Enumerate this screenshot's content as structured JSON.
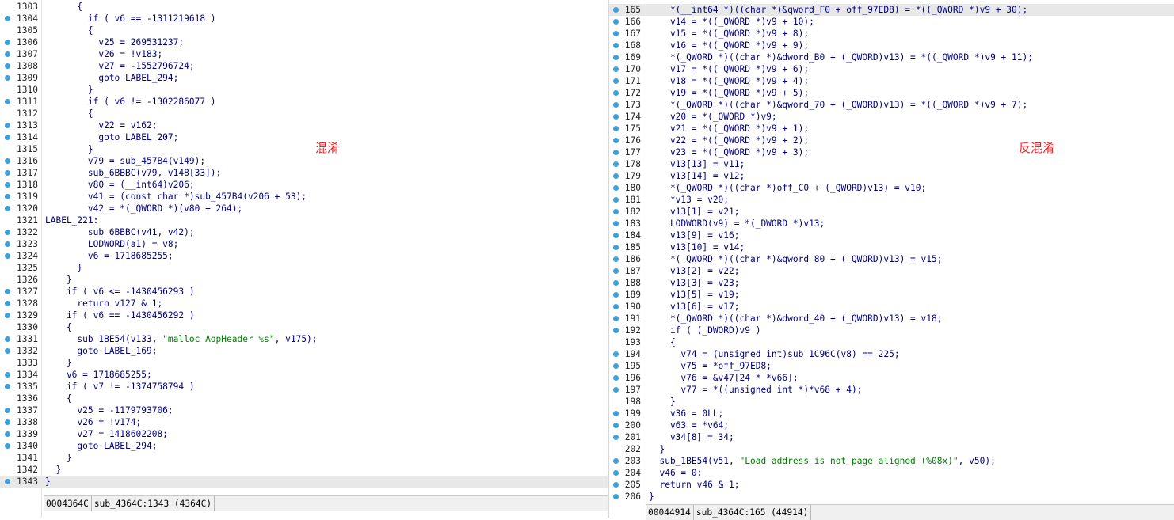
{
  "left_pane": {
    "lines": [
      {
        "num": "1303",
        "dot": false,
        "text": "      {"
      },
      {
        "num": "1304",
        "dot": true,
        "text": "        if ( v6 == -1311219618 )"
      },
      {
        "num": "1305",
        "dot": false,
        "text": "        {"
      },
      {
        "num": "1306",
        "dot": true,
        "text": "          v25 = 269531237;"
      },
      {
        "num": "1307",
        "dot": true,
        "text": "          v26 = !v183;"
      },
      {
        "num": "1308",
        "dot": true,
        "text": "          v27 = -1552796724;"
      },
      {
        "num": "1309",
        "dot": true,
        "text": "          goto LABEL_294;"
      },
      {
        "num": "1310",
        "dot": false,
        "text": "        }"
      },
      {
        "num": "1311",
        "dot": true,
        "text": "        if ( v6 != -1302286077 )"
      },
      {
        "num": "1312",
        "dot": false,
        "text": "        {"
      },
      {
        "num": "1313",
        "dot": true,
        "text": "          v22 = v162;"
      },
      {
        "num": "1314",
        "dot": true,
        "text": "          goto LABEL_207;"
      },
      {
        "num": "1315",
        "dot": false,
        "text": "        }"
      },
      {
        "num": "1316",
        "dot": true,
        "text": "        v79 = sub_457B4(v149);"
      },
      {
        "num": "1317",
        "dot": true,
        "text": "        sub_6BBBC(v79, v148[33]);"
      },
      {
        "num": "1318",
        "dot": true,
        "text": "        v80 = (__int64)v206;"
      },
      {
        "num": "1319",
        "dot": true,
        "text": "        v41 = (const char *)sub_457B4(v206 + 53);"
      },
      {
        "num": "1320",
        "dot": true,
        "text": "        v42 = *(_QWORD *)(v80 + 264);"
      },
      {
        "num": "1321",
        "dot": false,
        "text": "LABEL_221:"
      },
      {
        "num": "1322",
        "dot": true,
        "text": "        sub_6BBBC(v41, v42);"
      },
      {
        "num": "1323",
        "dot": true,
        "text": "        LODWORD(a1) = v8;"
      },
      {
        "num": "1324",
        "dot": true,
        "text": "        v6 = 1718685255;"
      },
      {
        "num": "1325",
        "dot": false,
        "text": "      }"
      },
      {
        "num": "1326",
        "dot": false,
        "text": "    }"
      },
      {
        "num": "1327",
        "dot": true,
        "text": "    if ( v6 <= -1430456293 )"
      },
      {
        "num": "1328",
        "dot": true,
        "text": "      return v127 & 1;"
      },
      {
        "num": "1329",
        "dot": true,
        "text": "    if ( v6 == -1430456292 )"
      },
      {
        "num": "1330",
        "dot": false,
        "text": "    {"
      },
      {
        "num": "1331",
        "dot": true,
        "text": "      sub_1BE54(v133, \"malloc AopHeader %s\", v175);"
      },
      {
        "num": "1332",
        "dot": true,
        "text": "      goto LABEL_169;"
      },
      {
        "num": "1333",
        "dot": false,
        "text": "    }"
      },
      {
        "num": "1334",
        "dot": true,
        "text": "    v6 = 1718685255;"
      },
      {
        "num": "1335",
        "dot": true,
        "text": "    if ( v7 != -1374758794 )"
      },
      {
        "num": "1336",
        "dot": false,
        "text": "    {"
      },
      {
        "num": "1337",
        "dot": true,
        "text": "      v25 = -1179793706;"
      },
      {
        "num": "1338",
        "dot": true,
        "text": "      v26 = !v174;"
      },
      {
        "num": "1339",
        "dot": true,
        "text": "      v27 = 1418602208;"
      },
      {
        "num": "1340",
        "dot": true,
        "text": "      goto LABEL_294;"
      },
      {
        "num": "1341",
        "dot": false,
        "text": "    }"
      },
      {
        "num": "1342",
        "dot": false,
        "text": "  }"
      },
      {
        "num": "1343",
        "dot": true,
        "text": "}",
        "highlight": true
      }
    ],
    "annotation": "混淆",
    "status": {
      "address": "0004364C",
      "location": "sub_4364C:1343 (4364C)"
    }
  },
  "right_pane": {
    "lines": [
      {
        "num": "165",
        "dot": true,
        "text": "    *(__int64 *)((char *)&qword_F0 + off_97ED8) = *((_QWORD *)v9 + 30);",
        "highlight": true
      },
      {
        "num": "166",
        "dot": true,
        "text": "    v14 = *((_QWORD *)v9 + 10);"
      },
      {
        "num": "167",
        "dot": true,
        "text": "    v15 = *((_QWORD *)v9 + 8);"
      },
      {
        "num": "168",
        "dot": true,
        "text": "    v16 = *((_QWORD *)v9 + 9);"
      },
      {
        "num": "169",
        "dot": true,
        "text": "    *(_QWORD *)((char *)&dword_B0 + (_QWORD)v13) = *((_QWORD *)v9 + 11);"
      },
      {
        "num": "170",
        "dot": true,
        "text": "    v17 = *((_QWORD *)v9 + 6);"
      },
      {
        "num": "171",
        "dot": true,
        "text": "    v18 = *((_QWORD *)v9 + 4);"
      },
      {
        "num": "172",
        "dot": true,
        "text": "    v19 = *((_QWORD *)v9 + 5);"
      },
      {
        "num": "173",
        "dot": true,
        "text": "    *(_QWORD *)((char *)&qword_70 + (_QWORD)v13) = *((_QWORD *)v9 + 7);"
      },
      {
        "num": "174",
        "dot": true,
        "text": "    v20 = *(_QWORD *)v9;"
      },
      {
        "num": "175",
        "dot": true,
        "text": "    v21 = *((_QWORD *)v9 + 1);"
      },
      {
        "num": "176",
        "dot": true,
        "text": "    v22 = *((_QWORD *)v9 + 2);"
      },
      {
        "num": "177",
        "dot": true,
        "text": "    v23 = *((_QWORD *)v9 + 3);"
      },
      {
        "num": "178",
        "dot": true,
        "text": "    v13[13] = v11;"
      },
      {
        "num": "179",
        "dot": true,
        "text": "    v13[14] = v12;"
      },
      {
        "num": "180",
        "dot": true,
        "text": "    *(_QWORD *)((char *)off_C0 + (_QWORD)v13) = v10;"
      },
      {
        "num": "181",
        "dot": true,
        "text": "    *v13 = v20;"
      },
      {
        "num": "182",
        "dot": true,
        "text": "    v13[1] = v21;"
      },
      {
        "num": "183",
        "dot": true,
        "text": "    LODWORD(v9) = *(_DWORD *)v13;"
      },
      {
        "num": "184",
        "dot": true,
        "text": "    v13[9] = v16;"
      },
      {
        "num": "185",
        "dot": true,
        "text": "    v13[10] = v14;"
      },
      {
        "num": "186",
        "dot": true,
        "text": "    *(_QWORD *)((char *)&qword_80 + (_QWORD)v13) = v15;"
      },
      {
        "num": "187",
        "dot": true,
        "text": "    v13[2] = v22;"
      },
      {
        "num": "188",
        "dot": true,
        "text": "    v13[3] = v23;"
      },
      {
        "num": "189",
        "dot": true,
        "text": "    v13[5] = v19;"
      },
      {
        "num": "190",
        "dot": true,
        "text": "    v13[6] = v17;"
      },
      {
        "num": "191",
        "dot": true,
        "text": "    *(_QWORD *)((char *)&dword_40 + (_QWORD)v13) = v18;"
      },
      {
        "num": "192",
        "dot": true,
        "text": "    if ( (_DWORD)v9 )"
      },
      {
        "num": "193",
        "dot": false,
        "text": "    {"
      },
      {
        "num": "194",
        "dot": true,
        "text": "      v74 = (unsigned int)sub_1C96C(v8) == 225;"
      },
      {
        "num": "195",
        "dot": true,
        "text": "      v75 = *off_97ED8;"
      },
      {
        "num": "196",
        "dot": true,
        "text": "      v76 = &v47[24 * *v66];"
      },
      {
        "num": "197",
        "dot": true,
        "text": "      v77 = *((unsigned int *)*v68 + 4);"
      },
      {
        "num": "198",
        "dot": false,
        "text": "    }"
      },
      {
        "num": "199",
        "dot": true,
        "text": "    v36 = 0LL;"
      },
      {
        "num": "200",
        "dot": true,
        "text": "    v63 = *v64;"
      },
      {
        "num": "201",
        "dot": true,
        "text": "    v34[8] = 34;"
      },
      {
        "num": "202",
        "dot": false,
        "text": "  }"
      },
      {
        "num": "203",
        "dot": true,
        "text": "  sub_1BE54(v51, \"Load address is not page aligned (%08x)\", v50);"
      },
      {
        "num": "204",
        "dot": true,
        "text": "  v46 = 0;"
      },
      {
        "num": "205",
        "dot": true,
        "text": "  return v46 & 1;"
      },
      {
        "num": "206",
        "dot": true,
        "text": "}"
      }
    ],
    "annotation": "反混淆",
    "status": {
      "address": "00044914",
      "location": "sub_4364C:165 (44914)"
    }
  },
  "colors": {
    "code_text": "#000080",
    "string_literal": "#008000",
    "variable": "#5f7fb0",
    "keyword_highlight": "#ffff66",
    "breakpoint_dot": "#3f9fd8",
    "annotation": "#e8232a",
    "current_line": "#e8e8e8"
  }
}
